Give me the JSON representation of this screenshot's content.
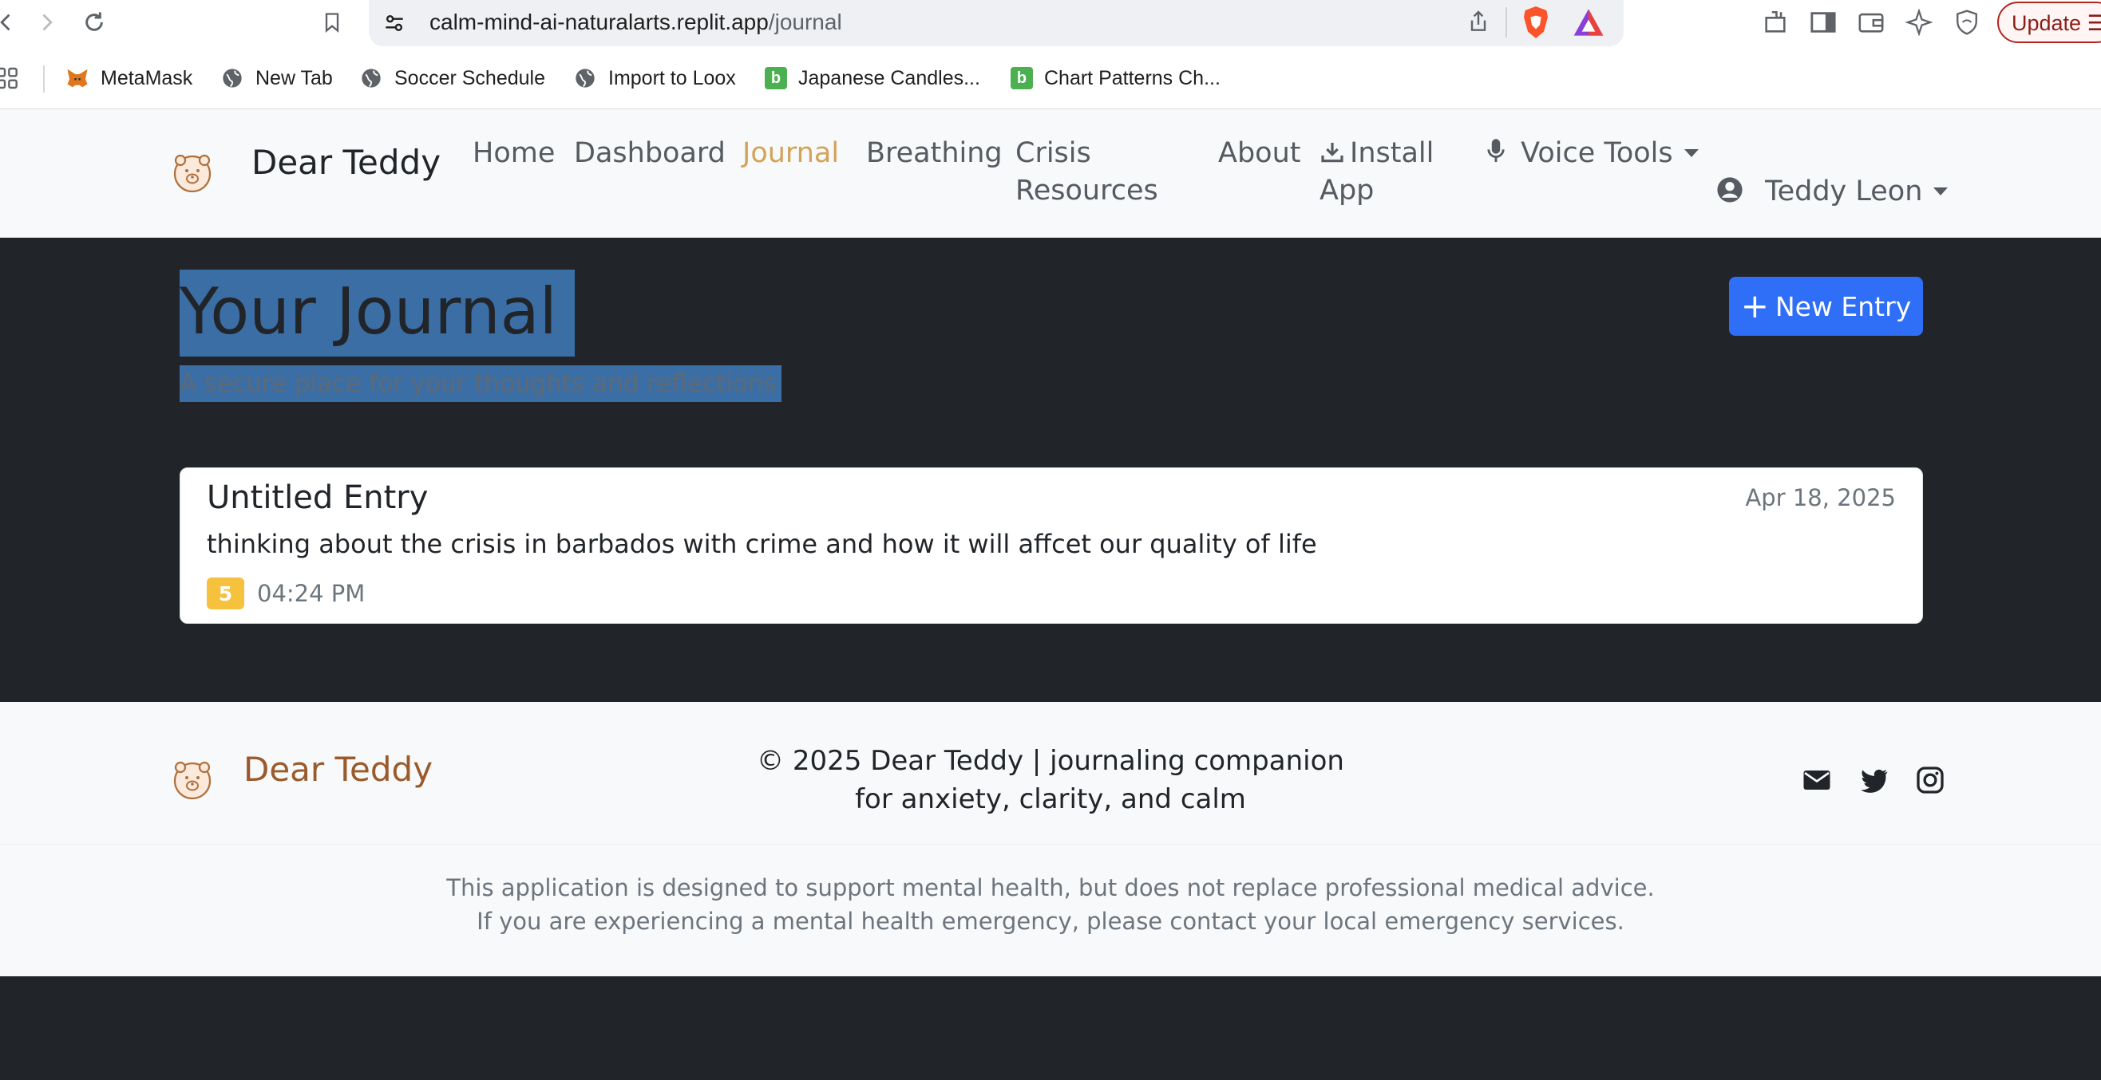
{
  "browser": {
    "url_host": "calm-mind-ai-naturalarts.replit.app",
    "url_path": "/journal",
    "update_label": "Update",
    "bookmarks": [
      {
        "label": "MetaMask",
        "icon": "metamask-fox-icon"
      },
      {
        "label": "New Tab",
        "icon": "globe-icon"
      },
      {
        "label": "Soccer Schedule",
        "icon": "globe-icon"
      },
      {
        "label": "Import to Loox",
        "icon": "globe-icon"
      },
      {
        "label": "Japanese Candles...",
        "icon": "b-green-icon"
      },
      {
        "label": "Chart Patterns Ch...",
        "icon": "b-green-icon"
      }
    ]
  },
  "navbar": {
    "brand": "Dear Teddy",
    "links": {
      "home": "Home",
      "dashboard": "Dashboard",
      "journal": "Journal",
      "breathing": "Breathing",
      "crisis_line1": "Crisis",
      "crisis_line2": "Resources",
      "about": "About",
      "install_line1": "Install",
      "install_line2": "App",
      "voice_tools": "Voice Tools",
      "user": "Teddy Leon"
    },
    "active": "journal"
  },
  "main": {
    "title": "Your Journal",
    "subtitle": "A secure place for your thoughts and reflections",
    "new_entry_label": "New Entry",
    "entries": [
      {
        "title": "Untitled Entry",
        "date": "Apr 18, 2025",
        "text": "thinking about the crisis in barbados with crime and how it will affcet our quality of life",
        "mood": "5",
        "time": "04:24 PM"
      }
    ]
  },
  "footer": {
    "brand": "Dear Teddy",
    "copyright_line1": "© 2025 Dear Teddy | journaling companion",
    "copyright_line2": "for anxiety, clarity, and calm",
    "disclaimer_line1": "This application is designed to support mental health, but does not replace professional medical advice.",
    "disclaimer_line2": "If you are experiencing a mental health emergency, please contact your local emergency services."
  },
  "colors": {
    "active_link": "#d4a35a",
    "primary_button": "#2f6ef7",
    "mood_badge": "#f6c23e",
    "footer_brand": "#9a5a2b",
    "dark_bg": "#212529"
  }
}
